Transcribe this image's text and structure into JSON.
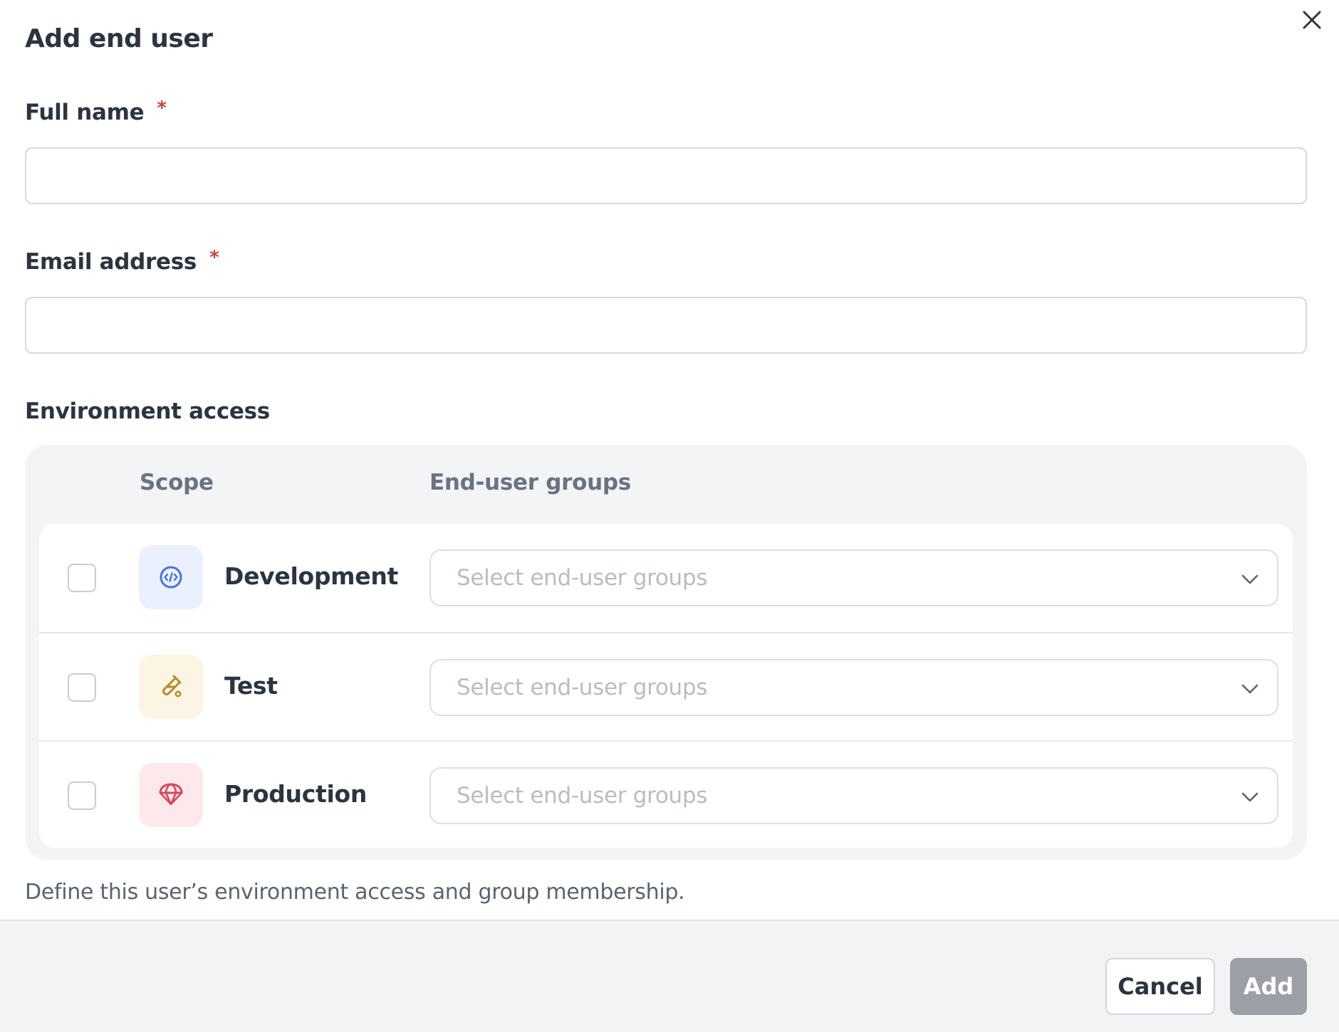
{
  "dialog": {
    "title": "Add end user",
    "close_icon": "close-icon"
  },
  "form": {
    "full_name": {
      "label": "Full name",
      "required_mark": "*",
      "value": "",
      "placeholder": ""
    },
    "email": {
      "label": "Email address",
      "required_mark": "*",
      "value": "",
      "placeholder": ""
    }
  },
  "environment_access": {
    "label": "Environment access",
    "columns": {
      "scope": "Scope",
      "groups": "End-user groups"
    },
    "rows": [
      {
        "name": "Development",
        "checked": false,
        "icon": "code-icon",
        "icon_color": "#4a72e0",
        "icon_bg": "#eaf0fe",
        "placeholder": "Select end-user groups"
      },
      {
        "name": "Test",
        "checked": false,
        "icon": "test-tube-icon",
        "icon_color": "#b98a2e",
        "icon_bg": "#fdf5e3",
        "placeholder": "Select end-user groups"
      },
      {
        "name": "Production",
        "checked": false,
        "icon": "parachute-icon",
        "icon_color": "#d9485a",
        "icon_bg": "#fde9ec",
        "placeholder": "Select end-user groups"
      }
    ],
    "help_text": "Define this user’s environment access and group membership."
  },
  "footer": {
    "cancel_label": "Cancel",
    "add_label": "Add",
    "add_disabled": true
  }
}
